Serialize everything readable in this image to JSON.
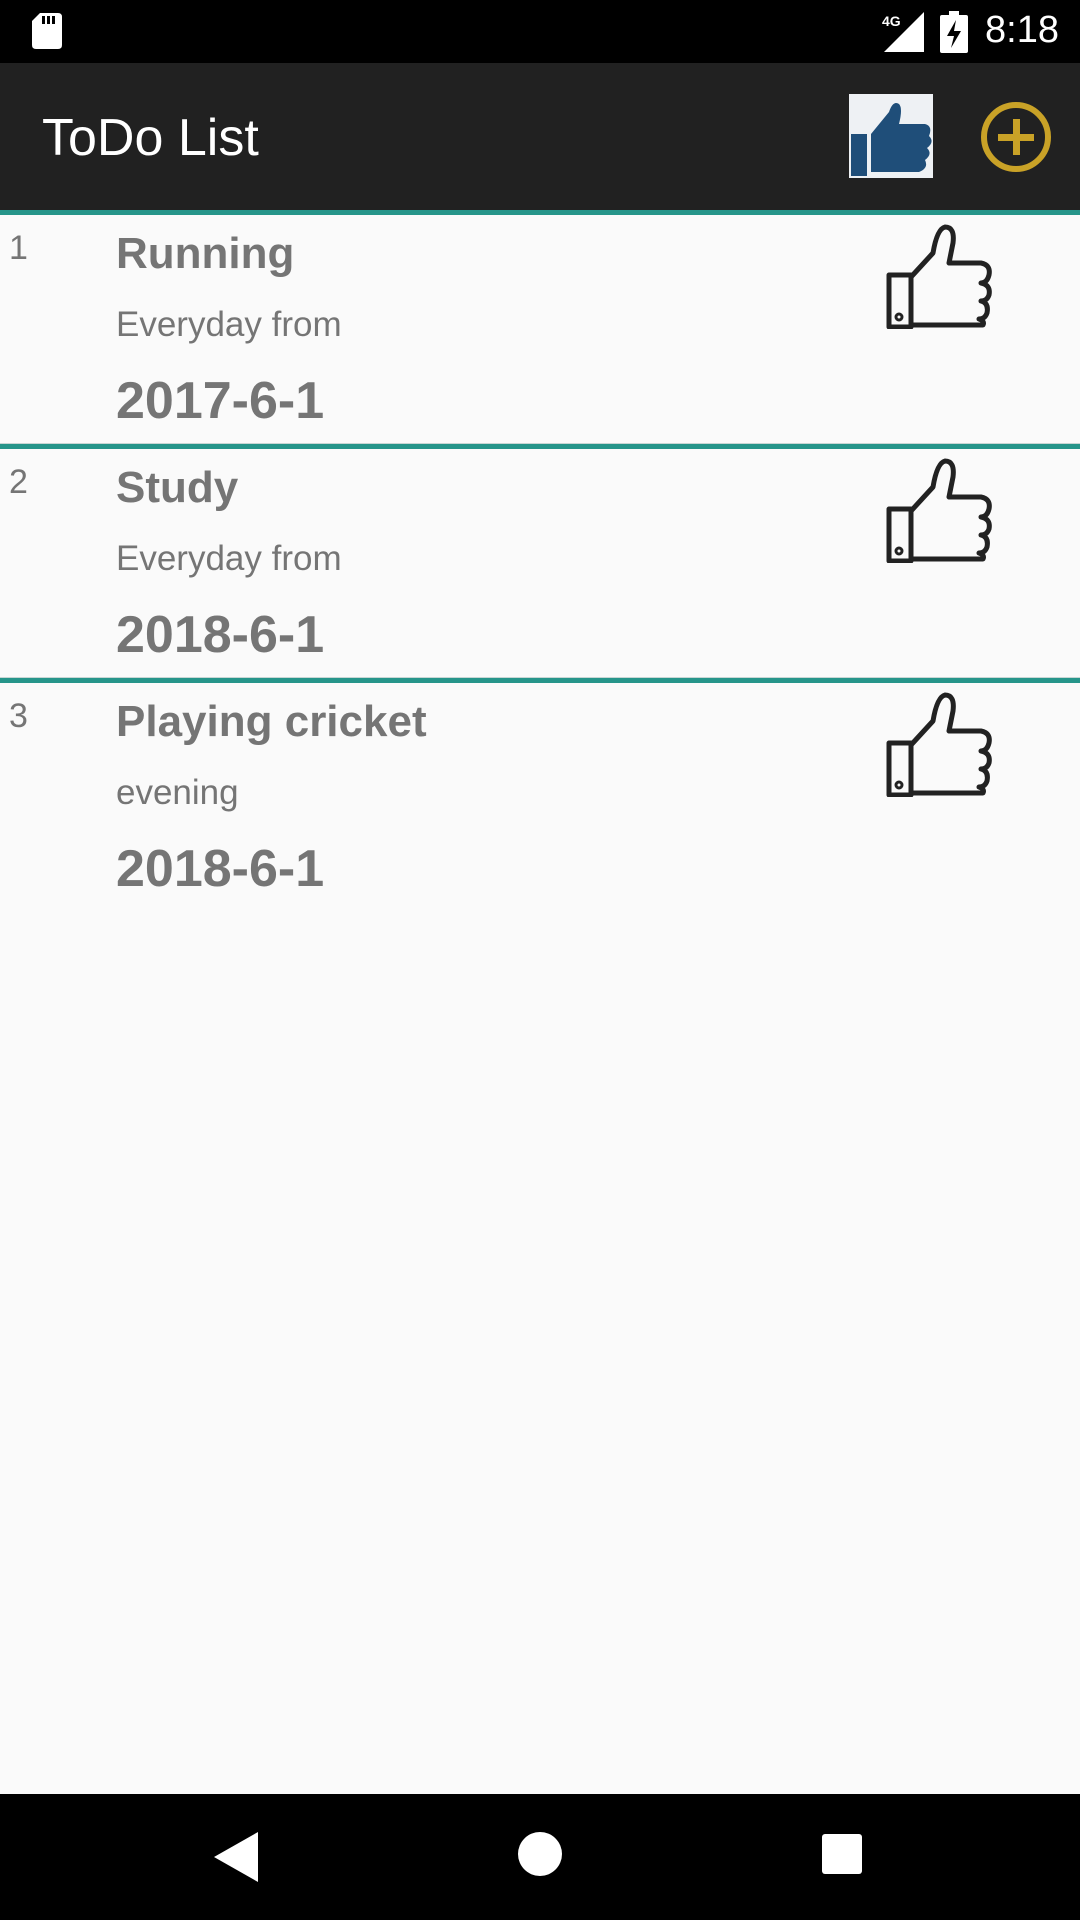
{
  "status_bar": {
    "time": "8:18",
    "network": "4G"
  },
  "app_bar": {
    "title": "ToDo List"
  },
  "colors": {
    "accent": "#26958a",
    "app_bar": "#212121",
    "add_icon": "#c9a227",
    "like_icon": "#1f4e79"
  },
  "todos": [
    {
      "number": "1",
      "title": "Running",
      "description": "Everyday from",
      "date": "2017-6-1"
    },
    {
      "number": "2",
      "title": "Study",
      "description": "Everyday from",
      "date": "2018-6-1"
    },
    {
      "number": "3",
      "title": "Playing cricket",
      "description": "evening",
      "date": "2018-6-1"
    }
  ]
}
